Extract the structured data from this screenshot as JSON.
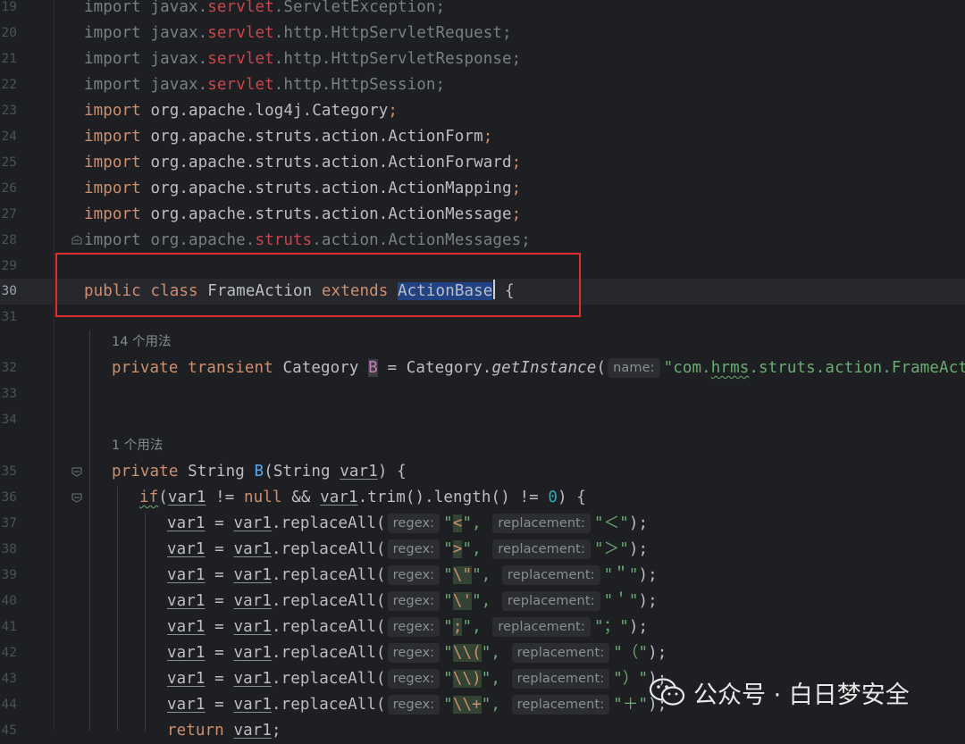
{
  "editor": {
    "lines": [
      {
        "number": "19",
        "text": "import javax.servlet.ServletException;"
      },
      {
        "number": "20",
        "text": "import javax.servlet.http.HttpServletRequest;"
      },
      {
        "number": "21",
        "text": "import javax.servlet.http.HttpServletResponse;"
      },
      {
        "number": "22",
        "text": "import javax.servlet.http.HttpSession;"
      },
      {
        "number": "23",
        "text": "import org.apache.log4j.Category;"
      },
      {
        "number": "24",
        "text": "import org.apache.struts.action.ActionForm;"
      },
      {
        "number": "25",
        "text": "import org.apache.struts.action.ActionForward;"
      },
      {
        "number": "26",
        "text": "import org.apache.struts.action.ActionMapping;"
      },
      {
        "number": "27",
        "text": "import org.apache.struts.action.ActionMessage;"
      },
      {
        "number": "28",
        "text": "import org.apache.struts.action.ActionMessages;"
      },
      {
        "number": "29",
        "text": ""
      },
      {
        "number": "30",
        "text": "public class FrameAction extends ActionBase {"
      },
      {
        "number": "31",
        "text": ""
      },
      {
        "number": "32",
        "text": "private transient Category B = Category.getInstance( name: \"com.hrms.struts.action.FrameActio"
      },
      {
        "number": "33",
        "text": ""
      },
      {
        "number": "34",
        "text": ""
      },
      {
        "number": "35",
        "text": "private String B(String var1) {"
      },
      {
        "number": "36",
        "text": "if(var1 != null && var1.trim().length() != 0) {"
      },
      {
        "number": "37",
        "text": "var1 = var1.replaceAll( regex: \"<\",  replacement: \"＜\");"
      },
      {
        "number": "38",
        "text": "var1 = var1.replaceAll( regex: \">\",  replacement: \"＞\");"
      },
      {
        "number": "39",
        "text": "var1 = var1.replaceAll( regex: \"\\\"\",  replacement: \"＂\");"
      },
      {
        "number": "40",
        "text": "var1 = var1.replaceAll( regex: \"\\'\",  replacement: \"＇\");"
      },
      {
        "number": "41",
        "text": "var1 = var1.replaceAll( regex: \";\",  replacement: \"；\");"
      },
      {
        "number": "42",
        "text": "var1 = var1.replaceAll( regex: \"\\\\(\",  replacement: \"（\");"
      },
      {
        "number": "43",
        "text": "var1 = var1.replaceAll( regex: \"\\\\)\",  replacement: \"）\");"
      },
      {
        "number": "44",
        "text": "var1 = var1.replaceAll( regex: \"\\\\+\",  replacement: \"＋\");"
      },
      {
        "number": "45",
        "text": "return var1;"
      }
    ],
    "usages": {
      "field_usages": "14 个用法",
      "method_usages": "1 个用法"
    },
    "hints": {
      "name": "name:",
      "regex": "regex:",
      "replacement": "replacement:"
    },
    "colors": {
      "background": "#1e1f22",
      "keyword": "#cf8e6d",
      "string": "#6aab73",
      "number": "#2aacb8",
      "field": "#c77dbb",
      "unresolved": "#c8464b",
      "selection": "#214283",
      "annotation_box": "#e02c2c"
    }
  },
  "watermark": {
    "text": "公众号 · 白日梦安全",
    "icon": "wechat-icon"
  }
}
